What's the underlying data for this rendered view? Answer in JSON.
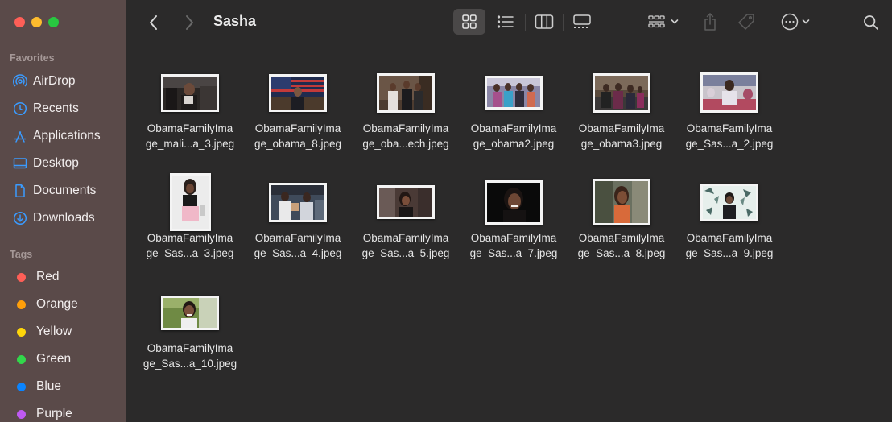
{
  "window": {
    "traffic_lights": {
      "close": "#fe5f57",
      "minimize": "#febc2e",
      "zoom": "#28c840"
    }
  },
  "sidebar": {
    "favorites_title": "Favorites",
    "favorites": [
      {
        "label": "AirDrop",
        "icon": "airdrop-icon"
      },
      {
        "label": "Recents",
        "icon": "clock-icon"
      },
      {
        "label": "Applications",
        "icon": "applications-icon"
      },
      {
        "label": "Desktop",
        "icon": "desktop-icon"
      },
      {
        "label": "Documents",
        "icon": "document-icon"
      },
      {
        "label": "Downloads",
        "icon": "download-icon"
      }
    ],
    "tags_title": "Tags",
    "tags": [
      {
        "label": "Red",
        "color": "#fe5f57"
      },
      {
        "label": "Orange",
        "color": "#fe9f0a"
      },
      {
        "label": "Yellow",
        "color": "#fed60a"
      },
      {
        "label": "Green",
        "color": "#32d74b"
      },
      {
        "label": "Blue",
        "color": "#0a84ff"
      },
      {
        "label": "Purple",
        "color": "#bf5af2"
      }
    ],
    "accent_color": "#3a9bff"
  },
  "toolbar": {
    "title": "Sasha",
    "back_icon": "chevron-left-icon",
    "forward_icon": "chevron-right-icon",
    "view_modes": [
      "icon-view-icon",
      "list-view-icon",
      "column-view-icon",
      "gallery-view-icon"
    ],
    "active_view": "icon-view-icon",
    "group_icon": "group-by-icon",
    "share_icon": "share-icon",
    "tag_icon": "tag-icon",
    "more_icon": "more-icon",
    "search_icon": "search-icon"
  },
  "files": [
    {
      "name": "ObamaFamilyIma\nge_mali...a_3.jpeg"
    },
    {
      "name": "ObamaFamilyIma\nge_obama_8.jpeg"
    },
    {
      "name": "ObamaFamilyIma\nge_oba...ech.jpeg"
    },
    {
      "name": "ObamaFamilyIma\nge_obama2.jpeg"
    },
    {
      "name": "ObamaFamilyIma\nge_obama3.jpeg"
    },
    {
      "name": "ObamaFamilyIma\nge_Sas...a_2.jpeg"
    },
    {
      "name": "ObamaFamilyIma\nge_Sas...a_3.jpeg"
    },
    {
      "name": "ObamaFamilyIma\nge_Sas...a_4.jpeg"
    },
    {
      "name": "ObamaFamilyIma\nge_Sas...a_5.jpeg"
    },
    {
      "name": "ObamaFamilyIma\nge_Sas...a_7.jpeg"
    },
    {
      "name": "ObamaFamilyIma\nge_Sas...a_8.jpeg"
    },
    {
      "name": "ObamaFamilyIma\nge_Sas...a_9.jpeg"
    },
    {
      "name": "ObamaFamilyIma\nge_Sas...a_10.jpeg"
    }
  ]
}
